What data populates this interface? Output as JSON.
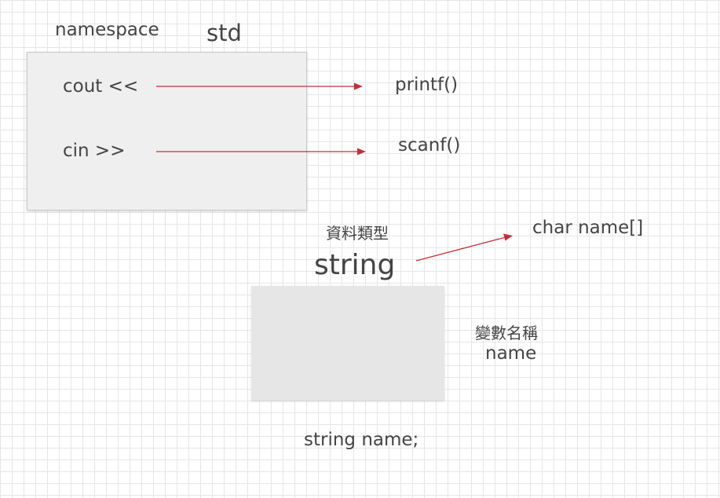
{
  "namespace_label": "namespace",
  "std_label": "std",
  "cout_label": "cout <<",
  "cin_label": "cin >>",
  "printf_label": "printf()",
  "scanf_label": "scanf()",
  "data_type_label": "資料類型",
  "string_label": "string",
  "char_name_label": "char name[]",
  "variable_name_label": "變數名稱",
  "name_label": "name",
  "declaration_label": "string name;",
  "arrow_color": "#c0303a"
}
